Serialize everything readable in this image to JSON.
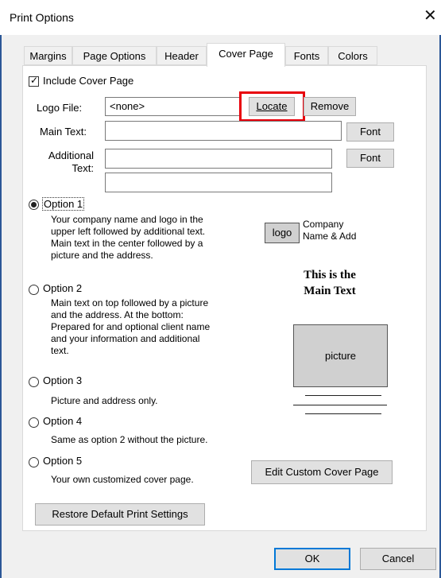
{
  "window": {
    "title": "Print Options",
    "close_symbol": "✕"
  },
  "tabs": [
    {
      "label": "Margins"
    },
    {
      "label": "Page Options"
    },
    {
      "label": "Header"
    },
    {
      "label": "Cover Page"
    },
    {
      "label": "Fonts"
    },
    {
      "label": "Colors"
    }
  ],
  "cover": {
    "include_label": "Include Cover Page",
    "include_checked": true,
    "logo_label": "Logo File:",
    "logo_value": "<none>",
    "locate_label": "Locate",
    "remove_label": "Remove",
    "main_text_label": "Main Text:",
    "main_text_value": "",
    "font_label": "Font",
    "additional_label_1": "Additional",
    "additional_label_2": "Text:",
    "additional_value_1": "",
    "additional_value_2": ""
  },
  "options": [
    {
      "key": "1",
      "title": "Option 1",
      "desc": [
        "Your company name and logo in the",
        "upper left followed by additional text.",
        "Main text in the center followed by a",
        "picture and the address."
      ],
      "selected": true
    },
    {
      "key": "2",
      "title": "Option 2",
      "desc": [
        "Main text on top followed by a picture",
        "and the address. At the bottom:",
        "Prepared for and optional client name",
        "and your information and additional",
        "text."
      ],
      "selected": false
    },
    {
      "key": "3",
      "title": "Option 3",
      "desc": [
        "Picture and address only."
      ],
      "selected": false
    },
    {
      "key": "4",
      "title": "Option 4",
      "desc": [
        "Same as option 2 without the picture."
      ],
      "selected": false
    },
    {
      "key": "5",
      "title": "Option 5",
      "desc": [
        "Your own customized cover page."
      ],
      "selected": false
    }
  ],
  "preview": {
    "logo_text": "logo",
    "company_line1": "Company",
    "company_line2": "Name & Add",
    "main_line1": "This is the",
    "main_line2": "Main Text",
    "picture_text": "picture"
  },
  "buttons": {
    "edit_custom": "Edit Custom Cover Page",
    "restore": "Restore Default Print Settings",
    "ok": "OK",
    "cancel": "Cancel"
  },
  "colors": {
    "highlight": "#e8000b",
    "accent": "#0078d7"
  }
}
